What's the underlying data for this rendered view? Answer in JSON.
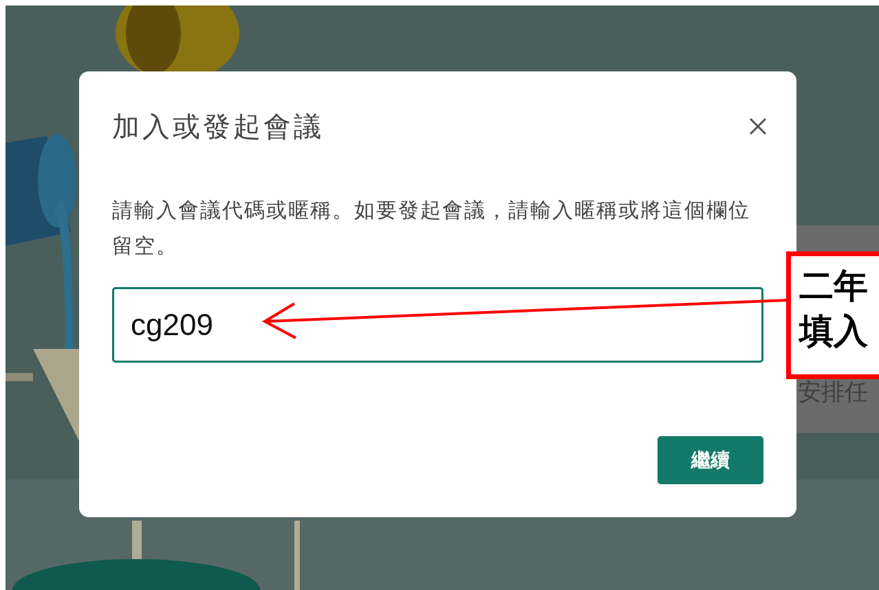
{
  "background_card": {
    "text": "安排任"
  },
  "dialog": {
    "title": "加入或發起會議",
    "description": "請輸入會議代碼或暱稱。如要發起會議，請輸入暱稱或將這個欄位留空。",
    "input": {
      "value": "cg209"
    },
    "buttons": [
      "繼續"
    ]
  },
  "annotation": {
    "lines": [
      "二年",
      "填入"
    ]
  }
}
